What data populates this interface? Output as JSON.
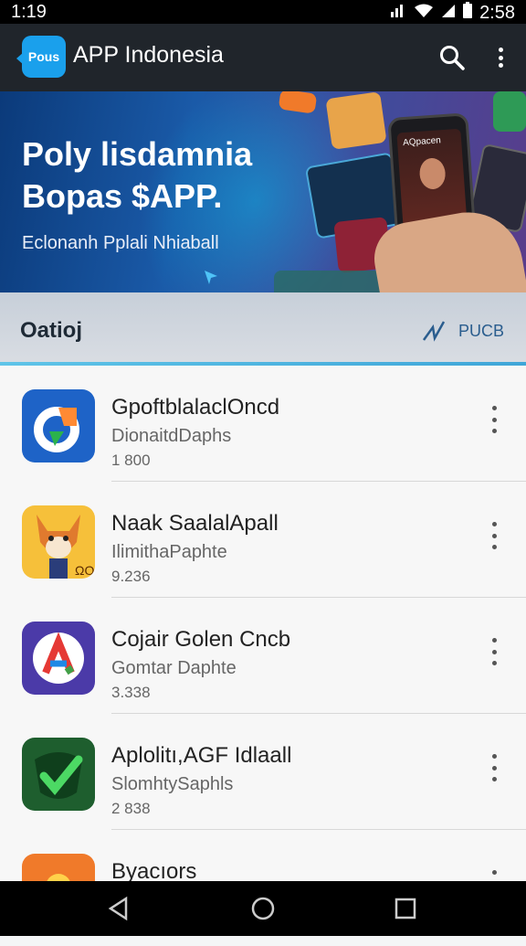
{
  "status_bar": {
    "time": "1:19",
    "clock_right": "2:58",
    "icons": [
      "signal-icon",
      "wifi-icon",
      "cell-icon",
      "battery-icon"
    ]
  },
  "app_bar": {
    "logo_text": "Pous",
    "title": "APP Indonesia"
  },
  "banner": {
    "line1": "Poly lisdamnia",
    "line2": "Bopas $APP.",
    "subtitle": "Eclonanh Pplali Nhiaball",
    "phone_label": "AQpacen"
  },
  "section": {
    "label": "Oatioj",
    "more_label": "PUCB"
  },
  "apps": [
    {
      "name": "GpoftblalaclOncd",
      "developer": "DionaitdDaphs",
      "size": "1 800",
      "icon": "g-logo-icon"
    },
    {
      "name": "Naak SaalalApall",
      "developer": "IlimithaPaphte",
      "size": "9.236",
      "icon": "fox-mascot-icon"
    },
    {
      "name": "Cojair Golen Cncb",
      "developer": "Gomtar Daphte",
      "size": "3.338",
      "icon": "a-logo-icon"
    },
    {
      "name": "Aplolitı,AGF Idlaall",
      "developer": "SlomhtySaphls",
      "size": "2 838",
      "icon": "check-shield-icon"
    },
    {
      "name": "Byacıors",
      "developer": "",
      "size": "",
      "icon": "orange-app-icon"
    }
  ],
  "nav": {
    "back": "back-icon",
    "home": "home-icon",
    "recents": "recents-icon"
  },
  "colors": {
    "app_bar": "#20252b",
    "accent": "#1aa0ec",
    "list_bg": "#f7f7f7"
  }
}
